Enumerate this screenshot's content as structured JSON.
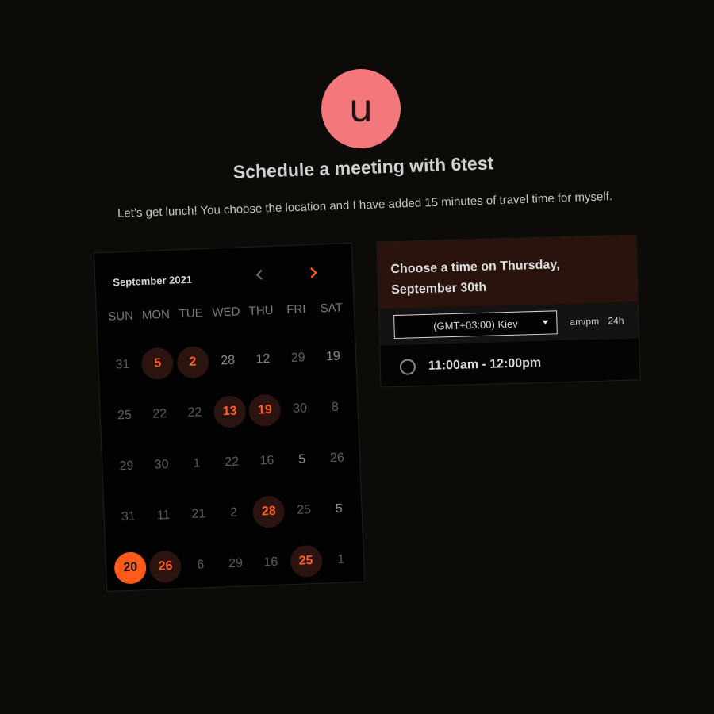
{
  "host": {
    "avatar_letter": "u",
    "avatar_color": "#f4787b",
    "title": "Schedule a meeting with 6test",
    "description": "Let’s get lunch! You choose the location and I have added 15 minutes of travel time for myself."
  },
  "calendar": {
    "month_label": "September 2021",
    "prev_icon": "chevron-left-icon",
    "next_icon": "chevron-right-icon",
    "weekdays": [
      "SUN",
      "MON",
      "TUE",
      "WED",
      "THU",
      "FRI",
      "SAT"
    ],
    "weeks": [
      [
        {
          "d": "31",
          "s": "off"
        },
        {
          "d": "5",
          "s": "avail"
        },
        {
          "d": "2",
          "s": "avail"
        },
        {
          "d": "28",
          "s": "off2"
        },
        {
          "d": "12",
          "s": "off2"
        },
        {
          "d": "29",
          "s": "off"
        },
        {
          "d": "19",
          "s": "off2"
        }
      ],
      [
        {
          "d": "25",
          "s": "off"
        },
        {
          "d": "22",
          "s": "off"
        },
        {
          "d": "22",
          "s": "off"
        },
        {
          "d": "13",
          "s": "avail"
        },
        {
          "d": "19",
          "s": "avail"
        },
        {
          "d": "30",
          "s": "off"
        },
        {
          "d": "8",
          "s": "off"
        }
      ],
      [
        {
          "d": "29",
          "s": "off"
        },
        {
          "d": "30",
          "s": "off"
        },
        {
          "d": "1",
          "s": "off"
        },
        {
          "d": "22",
          "s": "off"
        },
        {
          "d": "16",
          "s": "off"
        },
        {
          "d": "5",
          "s": "off2"
        },
        {
          "d": "26",
          "s": "off"
        }
      ],
      [
        {
          "d": "31",
          "s": "off"
        },
        {
          "d": "11",
          "s": "off"
        },
        {
          "d": "21",
          "s": "off"
        },
        {
          "d": "2",
          "s": "off"
        },
        {
          "d": "28",
          "s": "avail"
        },
        {
          "d": "25",
          "s": "off"
        },
        {
          "d": "5",
          "s": "off2"
        }
      ],
      [
        {
          "d": "20",
          "s": "sel"
        },
        {
          "d": "26",
          "s": "avail"
        },
        {
          "d": "6",
          "s": "off"
        },
        {
          "d": "29",
          "s": "off"
        },
        {
          "d": "16",
          "s": "off"
        },
        {
          "d": "25",
          "s": "avail"
        },
        {
          "d": "1",
          "s": "off"
        }
      ]
    ],
    "accent_color": "#ff5a1a"
  },
  "timepicker": {
    "heading": "Choose a time on Thursday, September 30th",
    "timezone": "(GMT+03:00) Kiev",
    "format_12h": "am/pm",
    "format_24h": "24h",
    "slots": [
      "11:00am - 12:00pm"
    ]
  }
}
